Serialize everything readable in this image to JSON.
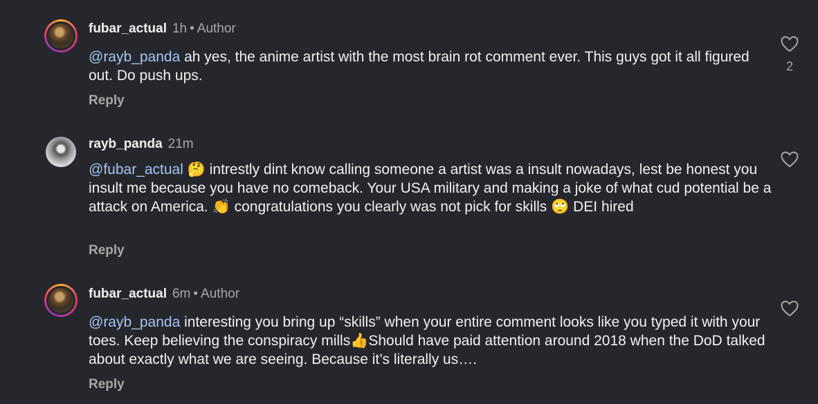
{
  "comments": [
    {
      "username": "fubar_actual",
      "time": "1h",
      "separator": "•",
      "badge": "Author",
      "mention": "@rayb_panda",
      "text_parts": [
        " ah yes, the anime artist with the most brain rot comment ever. This guys got it all figured out. Do push ups."
      ],
      "reply_label": "Reply",
      "like_count": "2",
      "avatar": "story-ring"
    },
    {
      "username": "rayb_panda",
      "time": "21m",
      "mention": "@fubar_actual",
      "emoji_1": "🤔",
      "text_1": " intrestly dint know calling someone a artist was a insult nowadays, lest be honest you insult me because you have no comeback. Your USA military and making a joke of what cud potential be a attack on America. ",
      "emoji_2": "👏",
      "text_2": " congratulations you clearly was not pick for skills ",
      "emoji_3": "🙄",
      "text_3": " DEI hired",
      "reply_label": "Reply",
      "avatar": "plain"
    },
    {
      "username": "fubar_actual",
      "time": "6m",
      "separator": "•",
      "badge": "Author",
      "mention": "@rayb_panda",
      "text_1": " interesting you bring up “skills” when your entire comment looks like you typed it with your toes. Keep believing the conspiracy mills",
      "emoji_1": "👍",
      "text_2": "Should have paid attention around 2018 when the DoD talked about exactly what we are seeing. Because it’s literally us….",
      "reply_label": "Reply",
      "avatar": "story-ring"
    }
  ],
  "icons": {
    "like": "heart-outline-icon"
  },
  "colors": {
    "background": "#25272c",
    "mention": "#a5c4f3",
    "secondary_text": "#a8a8a8",
    "primary_text": "#f1f1f1"
  }
}
